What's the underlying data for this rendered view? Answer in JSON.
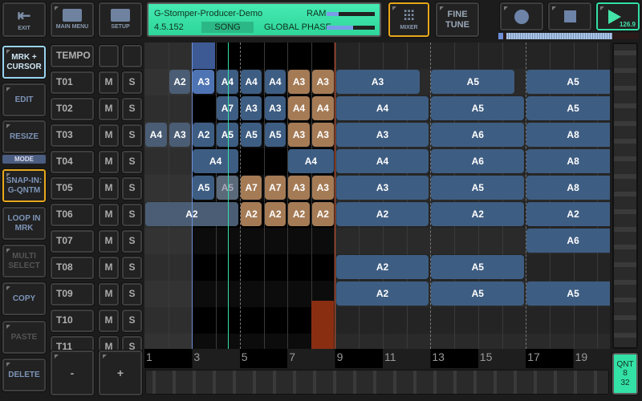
{
  "top": {
    "exit": "EXIT",
    "main_menu": "MAIN MENU",
    "setup": "SETUP",
    "mixer": "MIXER",
    "fine_tune": "FINE TUNE",
    "tempo_value": "126.9",
    "status": {
      "project": "G-Stomper-Producer-Demo",
      "version": "4.5.152",
      "mode": "SONG",
      "ram_label": "RAM",
      "ram_level": 0.25,
      "phase_label": "GLOBAL PHASE",
      "phase_level": 0.55
    }
  },
  "song_progress": 0.8,
  "side": {
    "mrk_cursor": "MRK + CURSOR",
    "edit": "EDIT",
    "resize": "RESIZE",
    "mode": "MODE",
    "snap": "SNAP-IN: G-QNTM",
    "loop": "LOOP IN MRK",
    "multi": "MULTI SELECT",
    "copy": "COPY",
    "paste": "PASTE",
    "delete": "DELETE"
  },
  "tracks": {
    "tempo": "TEMPO",
    "mute": "M",
    "solo": "S",
    "names": [
      "T01",
      "T02",
      "T03",
      "T04",
      "T05",
      "T06",
      "T07",
      "T08",
      "T09",
      "T10",
      "T11"
    ]
  },
  "minus": "-",
  "plus": "+",
  "qnt": {
    "label": "QNT",
    "num": "8",
    "den": "32"
  },
  "bar_numbers": [
    "1",
    "3",
    "5",
    "7",
    "9",
    "11",
    "13",
    "15",
    "17",
    "19"
  ],
  "colors": {
    "clip_blue": "#3e5d82",
    "clip_tan": "#a57b56",
    "clip_light": "#4a5d74",
    "clip_selected": "#4f74b4",
    "accent_green": "#33e0a6",
    "mixer_border": "#e8a81c"
  },
  "clips": [
    [
      {
        "s": 2,
        "l": 1,
        "t": "A2",
        "c": "light"
      },
      {
        "s": 3,
        "l": 1,
        "t": "A3",
        "c": "selected"
      },
      {
        "s": 4,
        "l": 1,
        "t": "A4",
        "c": "blue"
      },
      {
        "s": 5,
        "l": 1,
        "t": "A4",
        "c": "blue"
      },
      {
        "s": 6,
        "l": 1,
        "t": "A4",
        "c": "blue"
      },
      {
        "s": 7,
        "l": 1,
        "t": "A3",
        "c": "tan"
      },
      {
        "s": 8,
        "l": 1,
        "t": "A3",
        "c": "tan"
      },
      {
        "s": 9,
        "l": 3.6,
        "t": "A3",
        "c": "blue"
      },
      {
        "s": 13,
        "l": 3.6,
        "t": "A5",
        "c": "blue"
      },
      {
        "s": 17,
        "l": 4,
        "t": "A5",
        "c": "blue"
      }
    ],
    [
      {
        "s": 4,
        "l": 1,
        "t": "A7",
        "c": "blue"
      },
      {
        "s": 5,
        "l": 1,
        "t": "A3",
        "c": "blue"
      },
      {
        "s": 6,
        "l": 1,
        "t": "A3",
        "c": "blue"
      },
      {
        "s": 7,
        "l": 1,
        "t": "A4",
        "c": "tan"
      },
      {
        "s": 8,
        "l": 1,
        "t": "A4",
        "c": "tan"
      },
      {
        "s": 9,
        "l": 4,
        "t": "A4",
        "c": "blue"
      },
      {
        "s": 13,
        "l": 4,
        "t": "A5",
        "c": "blue"
      },
      {
        "s": 17,
        "l": 4,
        "t": "A5",
        "c": "blue"
      }
    ],
    [
      {
        "s": 1,
        "l": 1,
        "t": "A4",
        "c": "light"
      },
      {
        "s": 2,
        "l": 1,
        "t": "A3",
        "c": "light"
      },
      {
        "s": 3,
        "l": 1,
        "t": "A2",
        "c": "blue"
      },
      {
        "s": 4,
        "l": 1,
        "t": "A5",
        "c": "blue"
      },
      {
        "s": 5,
        "l": 1,
        "t": "A5",
        "c": "blue"
      },
      {
        "s": 6,
        "l": 1,
        "t": "A5",
        "c": "blue"
      },
      {
        "s": 7,
        "l": 1,
        "t": "A3",
        "c": "tan"
      },
      {
        "s": 8,
        "l": 1,
        "t": "A3",
        "c": "tan"
      },
      {
        "s": 9,
        "l": 4,
        "t": "A3",
        "c": "blue"
      },
      {
        "s": 13,
        "l": 4,
        "t": "A6",
        "c": "blue"
      },
      {
        "s": 17,
        "l": 4,
        "t": "A8",
        "c": "blue"
      }
    ],
    [
      {
        "s": 3,
        "l": 2,
        "t": "A4",
        "c": "blue"
      },
      {
        "s": 7,
        "l": 2,
        "t": "A4",
        "c": "blue"
      },
      {
        "s": 9,
        "l": 4,
        "t": "A4",
        "c": "blue"
      },
      {
        "s": 13,
        "l": 4,
        "t": "A6",
        "c": "blue"
      },
      {
        "s": 17,
        "l": 4,
        "t": "A8",
        "c": "blue"
      }
    ],
    [
      {
        "s": 3,
        "l": 1,
        "t": "A5",
        "c": "blue"
      },
      {
        "s": 4,
        "l": 1,
        "t": "A5",
        "c": "ghost"
      },
      {
        "s": 5,
        "l": 1,
        "t": "A7",
        "c": "tan"
      },
      {
        "s": 6,
        "l": 1,
        "t": "A7",
        "c": "tan"
      },
      {
        "s": 7,
        "l": 1,
        "t": "A3",
        "c": "tan"
      },
      {
        "s": 8,
        "l": 1,
        "t": "A3",
        "c": "tan"
      },
      {
        "s": 9,
        "l": 4,
        "t": "A3",
        "c": "blue"
      },
      {
        "s": 13,
        "l": 4,
        "t": "A5",
        "c": "blue"
      },
      {
        "s": 17,
        "l": 4,
        "t": "A8",
        "c": "blue"
      }
    ],
    [
      {
        "s": 1,
        "l": 4,
        "t": "A2",
        "c": "light"
      },
      {
        "s": 5,
        "l": 1,
        "t": "A2",
        "c": "tan"
      },
      {
        "s": 6,
        "l": 1,
        "t": "A2",
        "c": "tan"
      },
      {
        "s": 7,
        "l": 1,
        "t": "A2",
        "c": "tan"
      },
      {
        "s": 8,
        "l": 1,
        "t": "A2",
        "c": "tan"
      },
      {
        "s": 9,
        "l": 4,
        "t": "A2",
        "c": "blue"
      },
      {
        "s": 13,
        "l": 4,
        "t": "A2",
        "c": "blue"
      },
      {
        "s": 17,
        "l": 4,
        "t": "A2",
        "c": "blue"
      }
    ],
    [
      {
        "s": 17,
        "l": 4,
        "t": "A6",
        "c": "blue"
      }
    ],
    [
      {
        "s": 9,
        "l": 4,
        "t": "A2",
        "c": "blue"
      },
      {
        "s": 13,
        "l": 4,
        "t": "A5",
        "c": "blue"
      }
    ],
    [
      {
        "s": 9,
        "l": 4,
        "t": "A2",
        "c": "blue"
      },
      {
        "s": 13,
        "l": 4,
        "t": "A5",
        "c": "blue"
      },
      {
        "s": 17,
        "l": 4,
        "t": "A5",
        "c": "blue"
      }
    ],
    [],
    []
  ]
}
